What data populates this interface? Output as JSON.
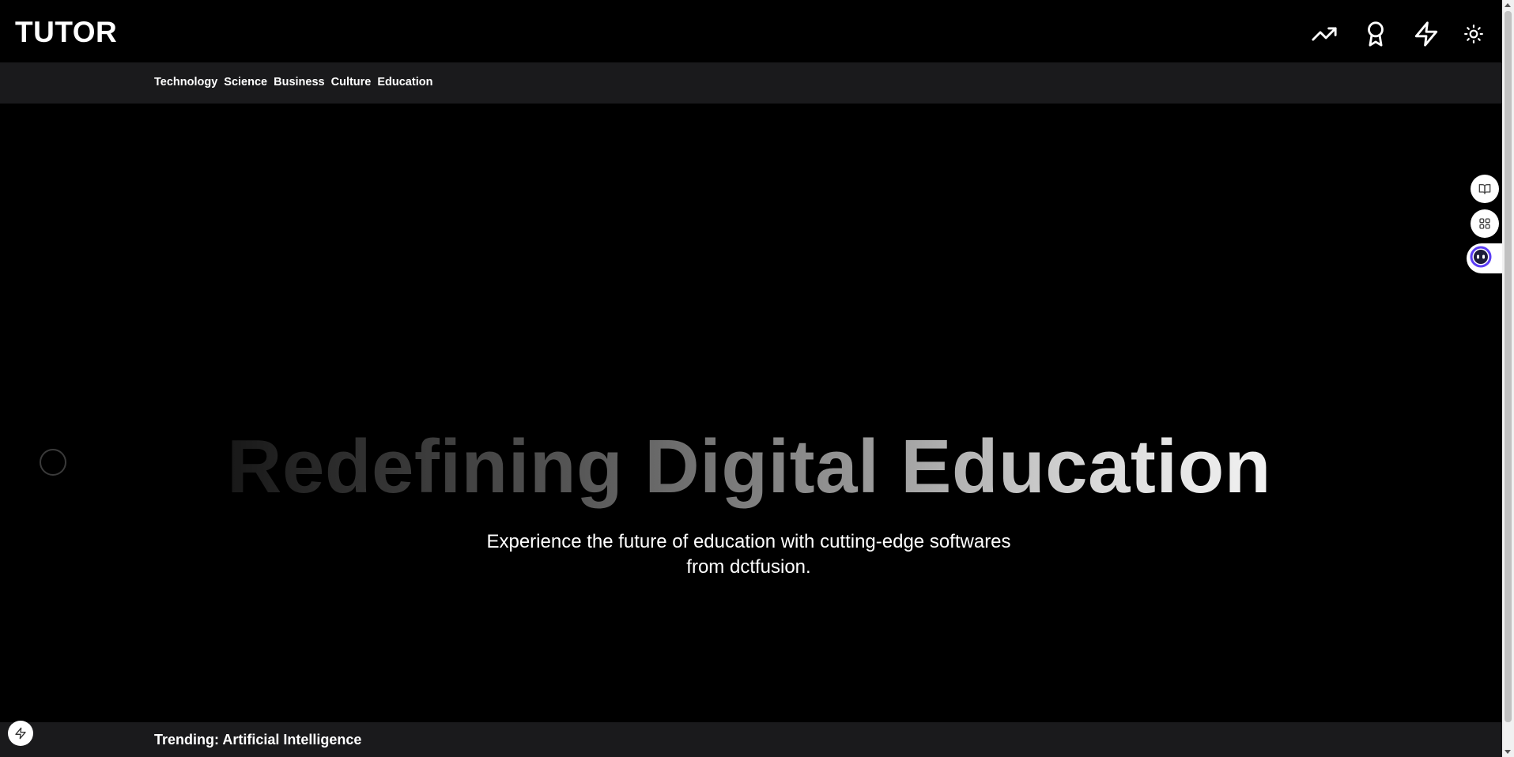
{
  "header": {
    "logo": "TUTOR",
    "icons": [
      "trending-up-icon",
      "award-icon",
      "bolt-icon",
      "sun-icon"
    ]
  },
  "nav": {
    "categories": [
      "Technology",
      "Science",
      "Business",
      "Culture",
      "Education"
    ]
  },
  "hero": {
    "title": "Redefining Digital Education",
    "subtitle": "Experience the future of education with cutting-edge softwares from dctfusion."
  },
  "side_buttons": [
    "book-open-icon",
    "grid-icon",
    "assistant-bot-icon"
  ],
  "trending": {
    "text": "Trending: Artificial Intelligence"
  },
  "colors": {
    "background": "#000000",
    "bar": "#1a1a1c",
    "text": "#ffffff",
    "bot_accent": "#5b3df5"
  }
}
